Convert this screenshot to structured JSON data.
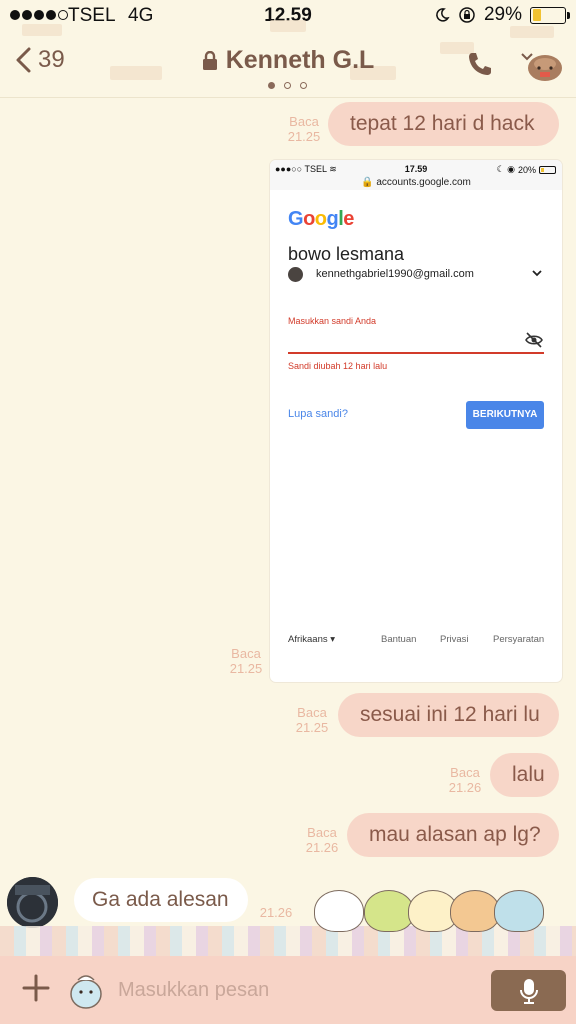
{
  "status_bar": {
    "carrier": "TSEL",
    "network": "4G",
    "time": "12.59",
    "battery": "29%",
    "battery_level": 0.29
  },
  "header": {
    "back_count": "39",
    "title": "Kenneth G.L",
    "page_index": 0,
    "page_count": 3
  },
  "messages": [
    {
      "dir": "out",
      "meta": "Baca",
      "time": "21.25",
      "text": "tepat 12 hari d hack"
    },
    {
      "dir": "out",
      "meta": "Baca",
      "time": "21.25",
      "type": "image"
    },
    {
      "dir": "out",
      "meta": "Baca",
      "time": "21.25",
      "text": "sesuai ini 12 hari lu"
    },
    {
      "dir": "out",
      "meta": "Baca",
      "time": "21.26",
      "text": "lalu"
    },
    {
      "dir": "out",
      "meta": "Baca",
      "time": "21.26",
      "text": "mau alasan ap lg?"
    },
    {
      "dir": "in",
      "time": "21.26",
      "text": "Ga ada alesan"
    }
  ],
  "screenshot": {
    "carrier": "TSEL",
    "time": "17.59",
    "battery": "20%",
    "url": "accounts.google.com",
    "logo": "Google",
    "name": "bowo lesmana",
    "email": "kennethgabriel1990@gmail.com",
    "password_label": "Masukkan sandi Anda",
    "hint": "Sandi diubah 12 hari lalu",
    "forgot": "Lupa sandi?",
    "next": "BERIKUTNYA",
    "language": "Afrikaans",
    "footer_help": "Bantuan",
    "footer_privacy": "Privasi",
    "footer_terms": "Persyaratan"
  },
  "input": {
    "placeholder": "Masukkan pesan"
  },
  "colors": {
    "background": "#fbf6e4",
    "bubble_out": "#f7d6c8",
    "bubble_in": "#ffffff",
    "accent": "#7a5a4a",
    "read_meta": "#e9b8a2",
    "input_bar": "#f7d3c6",
    "mic_button": "#8a6a52"
  },
  "icons": [
    "back-chevron-icon",
    "lock-icon",
    "phone-icon",
    "menu-chevron-icon",
    "plus-icon",
    "sticker-icon",
    "mic-icon"
  ]
}
